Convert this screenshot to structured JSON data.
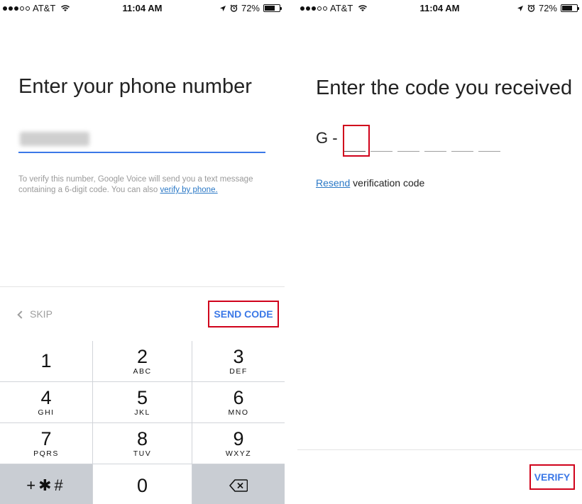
{
  "status_bar": {
    "carrier": "AT&T",
    "time": "11:04 AM",
    "battery": "72%",
    "battery_level": 0.72,
    "signal_bars_filled": 3,
    "signal_bars_total": 5
  },
  "phone_screen": {
    "title": "Enter your phone number",
    "helper_text": "To verify this number, Google Voice will send you a text message containing a 6-digit code. You can also ",
    "helper_link": "verify by phone.",
    "skip_label": "SKIP",
    "send_code_label": "SEND CODE",
    "keys": [
      {
        "num": "1",
        "letters": ""
      },
      {
        "num": "2",
        "letters": "ABC"
      },
      {
        "num": "3",
        "letters": "DEF"
      },
      {
        "num": "4",
        "letters": "GHI"
      },
      {
        "num": "5",
        "letters": "JKL"
      },
      {
        "num": "6",
        "letters": "MNO"
      },
      {
        "num": "7",
        "letters": "PQRS"
      },
      {
        "num": "8",
        "letters": "TUV"
      },
      {
        "num": "9",
        "letters": "WXYZ"
      },
      {
        "num": "+✱#",
        "letters": ""
      },
      {
        "num": "0",
        "letters": ""
      }
    ]
  },
  "code_screen": {
    "title": "Enter the code you received",
    "prefix": "G -",
    "code_length": 6,
    "resend_link": "Resend",
    "resend_text": " verification code",
    "verify_label": "VERIFY"
  },
  "colors": {
    "accent": "#3b78e7",
    "highlight": "#d0021b",
    "link": "#2a78c6"
  },
  "icons": [
    "wifi-icon",
    "location-arrow-icon",
    "alarm-icon",
    "battery-icon",
    "chevron-left-icon",
    "backspace-icon"
  ]
}
